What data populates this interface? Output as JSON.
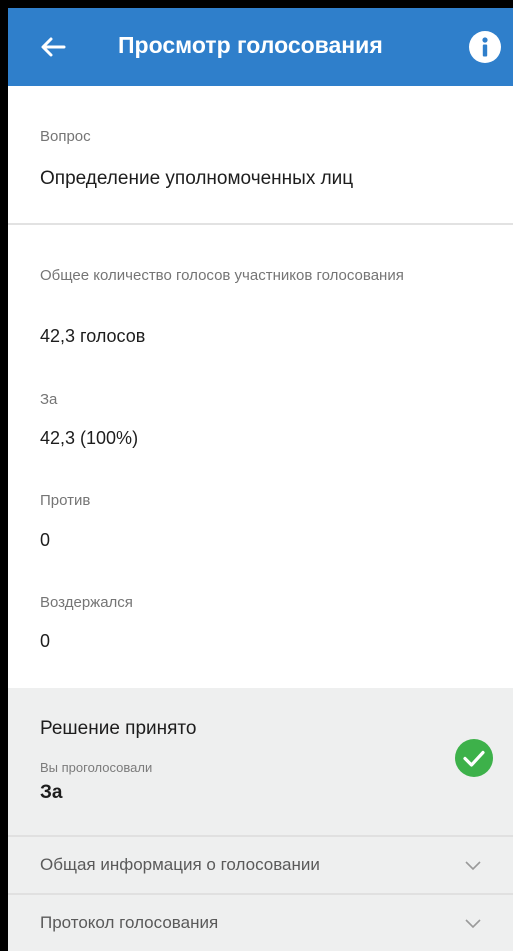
{
  "header": {
    "title": "Просмотр голосования",
    "back_icon": "back-arrow-icon",
    "info_icon": "info-icon",
    "color": "#2f7fcb"
  },
  "question": {
    "label": "Вопрос",
    "text": "Определение  уполномоченных лиц"
  },
  "results": {
    "total_label": "Общее количество голосов участников голосования",
    "total_value": "42,3 голосов",
    "for_label": "За",
    "for_value": "42,3 (100%)",
    "against_label": "Против",
    "against_value": "0",
    "abstained_label": "Воздержался",
    "abstained_value": "0"
  },
  "decision": {
    "title": "Решение принято",
    "voted_label": "Вы проголосовали",
    "voted_value": "За",
    "status_icon": "check-circle-icon",
    "status_color": "#3db14a"
  },
  "sections": [
    {
      "label": "Общая информация о голосовании",
      "icon": "chevron-down-icon"
    },
    {
      "label": "Протокол голосования",
      "icon": "chevron-down-icon"
    }
  ]
}
